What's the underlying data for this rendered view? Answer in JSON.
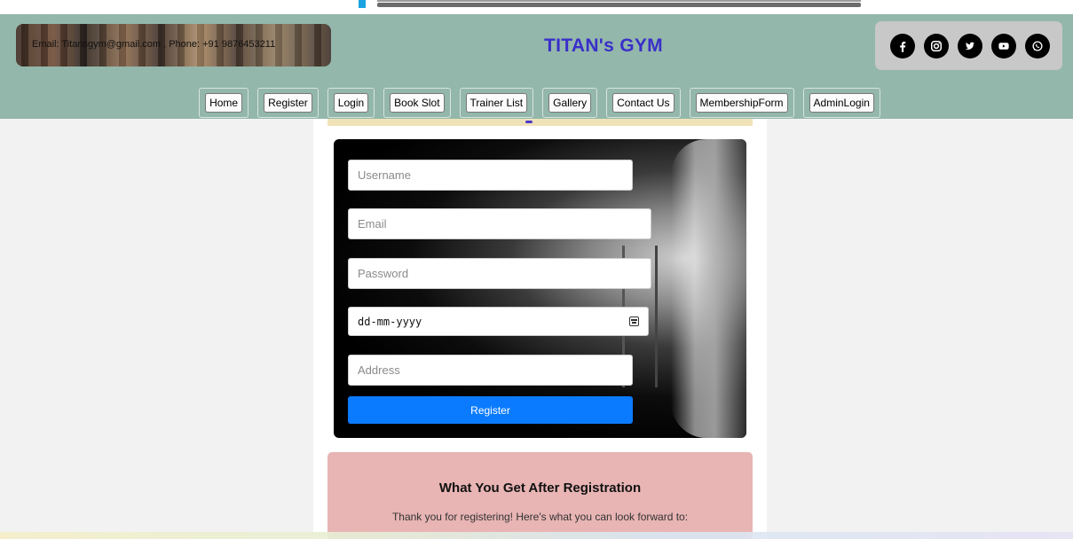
{
  "header": {
    "contact_text": "Email: Titansgym@gmail.com , Phone: +91 9876453211",
    "site_title": "TITAN's GYM",
    "social_icons": [
      "facebook-icon",
      "instagram-icon",
      "twitter-icon",
      "youtube-icon",
      "whatsapp-icon"
    ]
  },
  "nav": {
    "items": [
      {
        "label": "Home"
      },
      {
        "label": "Register"
      },
      {
        "label": "Login"
      },
      {
        "label": "Book Slot"
      },
      {
        "label": "Trainer List"
      },
      {
        "label": "Gallery"
      },
      {
        "label": "Contact Us"
      },
      {
        "label": "MembershipForm"
      },
      {
        "label": "AdminLogin"
      }
    ]
  },
  "form": {
    "username_placeholder": "Username",
    "email_placeholder": "Email",
    "password_placeholder": "Password",
    "date_placeholder": "dd-mm-yyyy",
    "address_placeholder": "Address",
    "submit_label": "Register"
  },
  "info": {
    "title": "What You Get After Registration",
    "text": "Thank you for registering! Here's what you can look forward to:"
  },
  "colors": {
    "header_bg": "#93b7ab",
    "title_color": "#3a2fc9",
    "button_blue": "#0a7bff",
    "info_bg": "#e8b4b4"
  }
}
